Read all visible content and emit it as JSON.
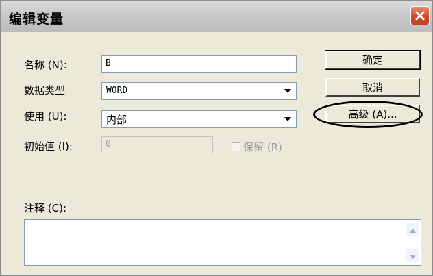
{
  "dialog": {
    "title": "编辑变量",
    "close_icon": "close-icon"
  },
  "fields": {
    "name_label": "名称 (N):",
    "name_value": "B",
    "datatype_label": "数据类型",
    "datatype_value": "WORD",
    "usage_label": "使用 (U):",
    "usage_value": "内部",
    "initial_label": "初始值 (I):",
    "initial_value": "0",
    "retain_label": "保留 (R)",
    "retain_checked": false,
    "comment_label": "注释 (C):",
    "comment_value": ""
  },
  "buttons": {
    "ok": "确定",
    "cancel": "取消",
    "advanced": "高级 (A)..."
  },
  "colors": {
    "dialog_bg": "#ece9d8",
    "close_red": "#d2472a",
    "input_border": "#7f9db9"
  }
}
